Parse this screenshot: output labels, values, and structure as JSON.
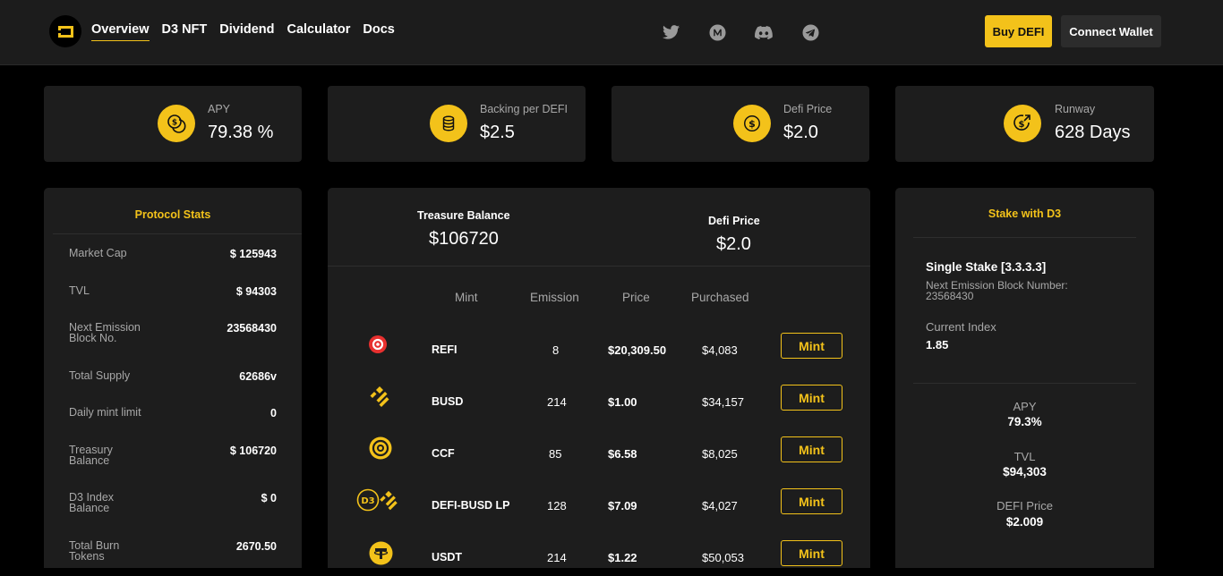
{
  "header": {
    "nav": [
      "Overview",
      "D3 NFT",
      "Dividend",
      "Calculator",
      "Docs"
    ],
    "socials": [
      "twitter-icon",
      "medium-icon",
      "discord-icon",
      "telegram-icon"
    ],
    "buy_label": "Buy DEFI",
    "wallet_label": "Connect Wallet"
  },
  "colors": {
    "accent": "#f3c21a",
    "card": "#1d1d1d",
    "header": "#1c1c1c",
    "muted": "#a8a8a8"
  },
  "stats": [
    {
      "label": "APY",
      "value": "79.38 %",
      "icon": "coins-icon"
    },
    {
      "label": "Backing per DEFI",
      "value": "$2.5",
      "icon": "coin-stack-icon"
    },
    {
      "label": "Defi Price",
      "value": "$2.0",
      "icon": "dollar-coin-icon"
    },
    {
      "label": "Runway",
      "value": "628 Days",
      "icon": "dollar-growth-icon"
    }
  ],
  "protocol": {
    "title": "Protocol Stats",
    "rows": [
      {
        "label": "Market Cap",
        "value": "$ 125943"
      },
      {
        "label": "TVL",
        "value": "$ 94303"
      },
      {
        "label": "Next Emission Block No.",
        "value": "23568430"
      },
      {
        "label": "Total Supply",
        "value": "62686v"
      },
      {
        "label": "Daily mint limit",
        "value": "0"
      },
      {
        "label": "Treasury Balance",
        "value": "$ 106720"
      },
      {
        "label": "D3 Index Balance",
        "value": "$ 0"
      },
      {
        "label": "Total Burn Tokens",
        "value": "2670.50"
      }
    ]
  },
  "treasury": {
    "balance_label": "Treasure Balance",
    "balance_value": "$106720",
    "price_label": "Defi Price",
    "price_value": "$2.0"
  },
  "mint_table": {
    "headers": [
      "Mint",
      "Emission",
      "Price",
      "Purchased"
    ],
    "button_label": "Mint",
    "rows": [
      {
        "name": "REFI",
        "emission": "8",
        "price": "$20,309.50",
        "purchased": "$4,083",
        "icon": "refi-icon"
      },
      {
        "name": "BUSD",
        "emission": "214",
        "price": "$1.00",
        "purchased": "$34,157",
        "icon": "busd-icon"
      },
      {
        "name": "CCF",
        "emission": "85",
        "price": "$6.58",
        "purchased": "$8,025",
        "icon": "ccf-icon"
      },
      {
        "name": "DEFI-BUSD LP",
        "emission": "128",
        "price": "$7.09",
        "purchased": "$4,027",
        "icon": "defi-busd-lp-icon"
      },
      {
        "name": "USDT",
        "emission": "214",
        "price": "$1.22",
        "purchased": "$50,053",
        "icon": "usdt-icon"
      }
    ]
  },
  "stake": {
    "title": "Stake with D3",
    "name": "Single Stake [3.3.3.3]",
    "block_label": "Next Emission Block Number:",
    "block_value": "23568430",
    "index_label": "Current Index",
    "index_value": "1.85",
    "metrics": [
      {
        "label": "APY",
        "value": "79.3%"
      },
      {
        "label": "TVL",
        "value": "$94,303"
      },
      {
        "label": "DEFI Price",
        "value": "$2.009"
      }
    ]
  }
}
